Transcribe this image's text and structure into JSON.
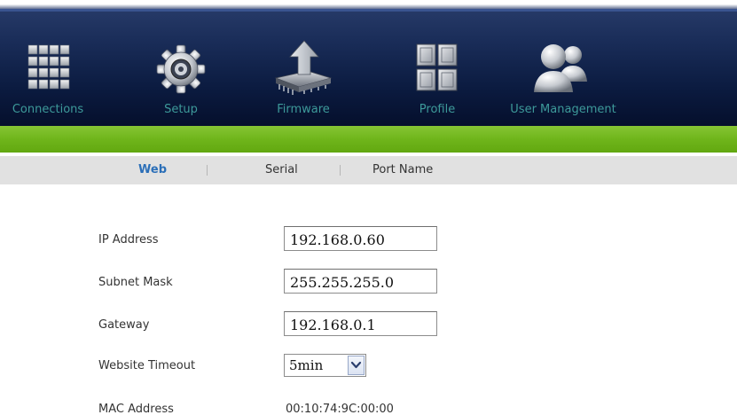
{
  "nav": {
    "items": [
      {
        "label": "Connections",
        "icon": "grid-icon"
      },
      {
        "label": "Setup",
        "icon": "gear-icon"
      },
      {
        "label": "Firmware",
        "icon": "chip-upload-icon"
      },
      {
        "label": "Profile",
        "icon": "panels-icon"
      },
      {
        "label": "User Management",
        "icon": "users-icon"
      }
    ],
    "selected": "Setup"
  },
  "subnav": {
    "tabs": [
      {
        "label": "Web",
        "active": true
      },
      {
        "label": "Serial",
        "active": false
      },
      {
        "label": "Port Name",
        "active": false
      }
    ]
  },
  "form": {
    "ip_address": {
      "label": "IP Address",
      "value": "192.168.0.60"
    },
    "subnet_mask": {
      "label": "Subnet Mask",
      "value": "255.255.255.0"
    },
    "gateway": {
      "label": "Gateway",
      "value": "192.168.0.1"
    },
    "website_timeout": {
      "label": "Website Timeout",
      "value": "5min"
    },
    "mac_address": {
      "label": "MAC Address",
      "value": "00:10:74:9C:00:00"
    }
  },
  "colors": {
    "nav_background": "#0b1b40",
    "nav_label": "#3d9a9a",
    "green_bar": "#6fb51b",
    "subnav_background": "#e1e1e1",
    "active_tab": "#2b6fb8",
    "text": "#333333"
  }
}
